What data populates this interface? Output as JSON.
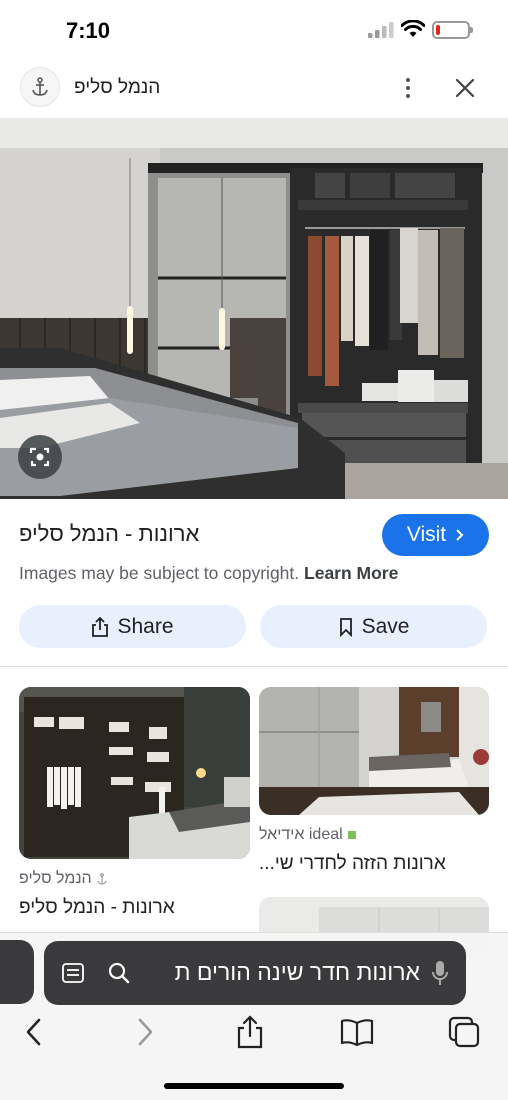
{
  "status_bar": {
    "time": "7:10"
  },
  "header": {
    "source_name": "הנמל סליפ"
  },
  "result": {
    "title": "ארונות - הנמל סליפ",
    "visit_label": "Visit",
    "copyright_text": "Images may be subject to copyright.",
    "learn_more": "Learn More",
    "share_label": "Share",
    "save_label": "Save"
  },
  "related": [
    {
      "source": "הנמל סליפ",
      "title": "ארונות - הנמל סליפ"
    },
    {
      "source": "ideal אידיאל",
      "title": "ארונות הזזה לחדרי שי..."
    }
  ],
  "browser": {
    "address_text": "ארונות חדר שינה הורים ת"
  },
  "colors": {
    "accent": "#1a73e8",
    "action_bg": "#e8f0fe",
    "address_bar": "#3a3a3c",
    "battery_low": "#e0291f"
  },
  "icons": [
    "signal-icon",
    "wifi-icon",
    "battery-icon",
    "anchor-icon",
    "more-icon",
    "close-icon",
    "lens-icon",
    "share-icon",
    "bookmark-icon",
    "tabs-icon",
    "search-icon",
    "mic-icon",
    "back-icon",
    "forward-icon",
    "bookmarks-icon"
  ]
}
